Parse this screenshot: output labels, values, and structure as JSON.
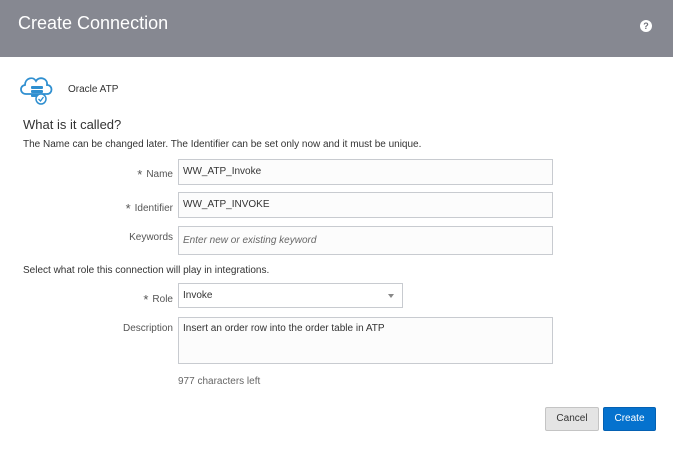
{
  "dialog": {
    "title": "Create Connection",
    "help_glyph": "?"
  },
  "adapter": {
    "name": "Oracle ATP",
    "icon": "cloud-database-icon"
  },
  "section": {
    "title": "What is it called?",
    "description": "The Name can be changed later. The Identifier can be set only now and it must be unique."
  },
  "fields": {
    "required_mark": "*",
    "name": {
      "label": "Name",
      "value": "WW_ATP_Invoke"
    },
    "identifier": {
      "label": "Identifier",
      "value": "WW_ATP_INVOKE"
    },
    "keywords": {
      "label": "Keywords",
      "placeholder": "Enter new or existing keyword"
    },
    "role_description": "Select what role this connection will play in integrations.",
    "role": {
      "label": "Role",
      "value": "Invoke"
    },
    "description": {
      "label": "Description",
      "value": "Insert an order row into the order table in ATP"
    },
    "chars_left": "977 characters left"
  },
  "buttons": {
    "cancel": "Cancel",
    "create": "Create"
  },
  "colors": {
    "header": "#868891",
    "primary": "#0572ce",
    "icon": "#2f8fd0"
  }
}
